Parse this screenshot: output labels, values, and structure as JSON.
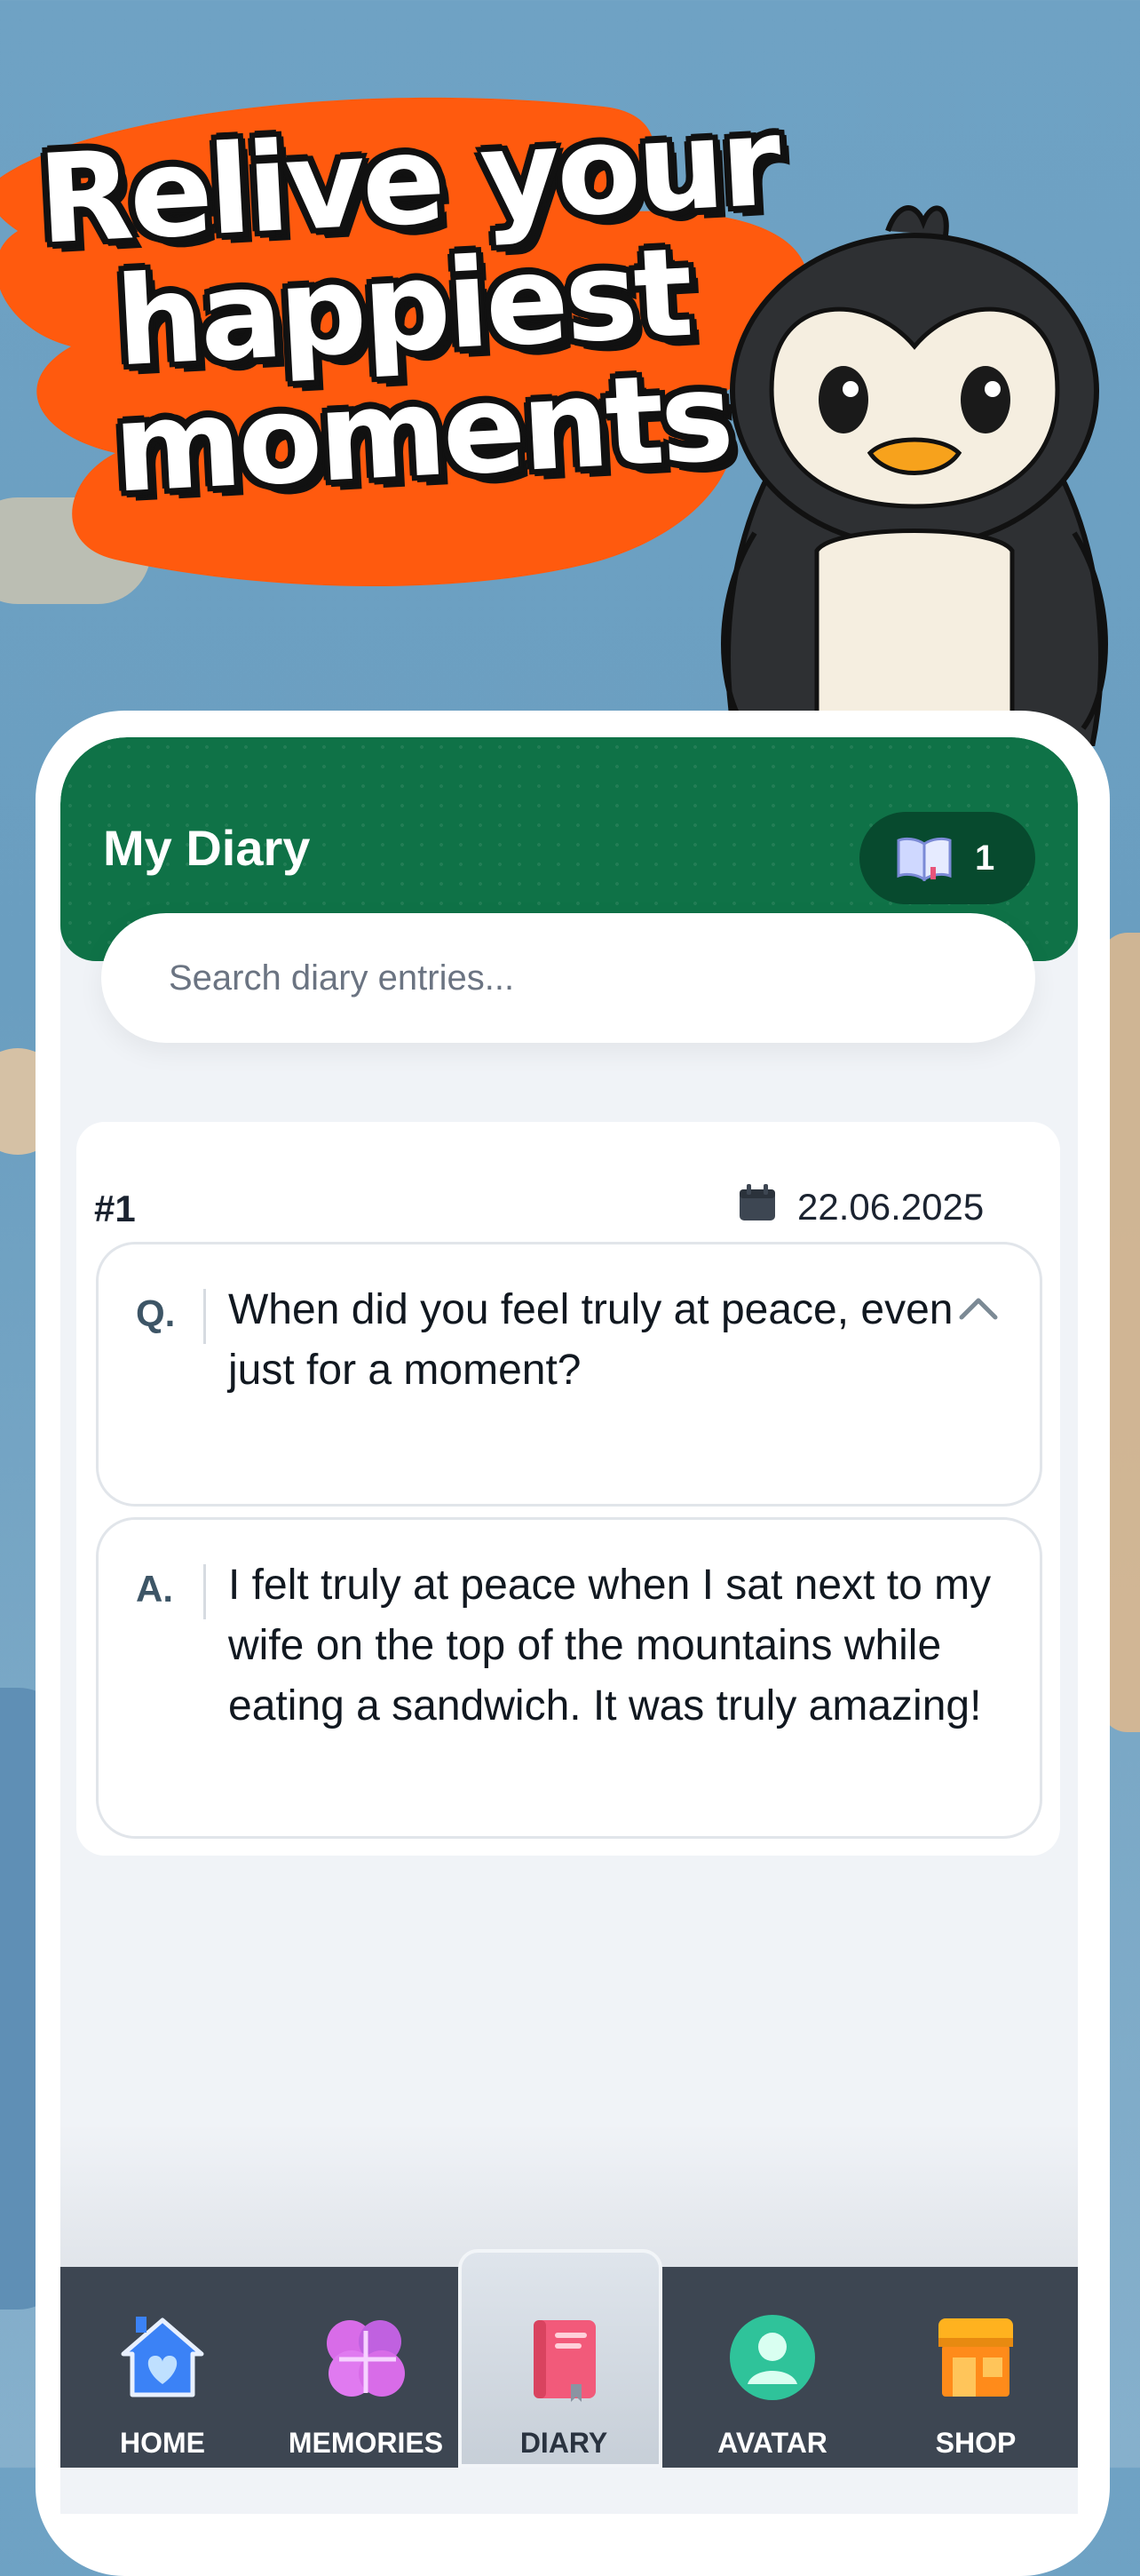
{
  "promo": {
    "headline_lines": [
      "Relive your",
      "happiest",
      "moments"
    ],
    "blob_color": "#ff5a0e"
  },
  "header": {
    "title": "My Diary",
    "entry_count": "1",
    "book_icon": "open-book-icon",
    "color": "#0f7247"
  },
  "search": {
    "placeholder": "Search diary entries...",
    "value": ""
  },
  "entries": [
    {
      "number": "#1",
      "date": "22.06.2025",
      "question_label": "Q.",
      "question": "When did you feel truly at peace, even just for a moment?",
      "answer_label": "A.",
      "answer": "I felt truly at peace when I sat next to my wife on the top of the mountains while eating a sandwich. It was truly amazing!"
    }
  ],
  "nav": {
    "active": "DIARY",
    "tabs": [
      {
        "label": "HOME",
        "icon": "home-heart-icon"
      },
      {
        "label": "MEMORIES",
        "icon": "puzzle-brain-icon"
      },
      {
        "label": "DIARY",
        "icon": "diary-book-icon"
      },
      {
        "label": "AVATAR",
        "icon": "user-avatar-icon"
      },
      {
        "label": "SHOP",
        "icon": "shop-store-icon"
      }
    ]
  }
}
